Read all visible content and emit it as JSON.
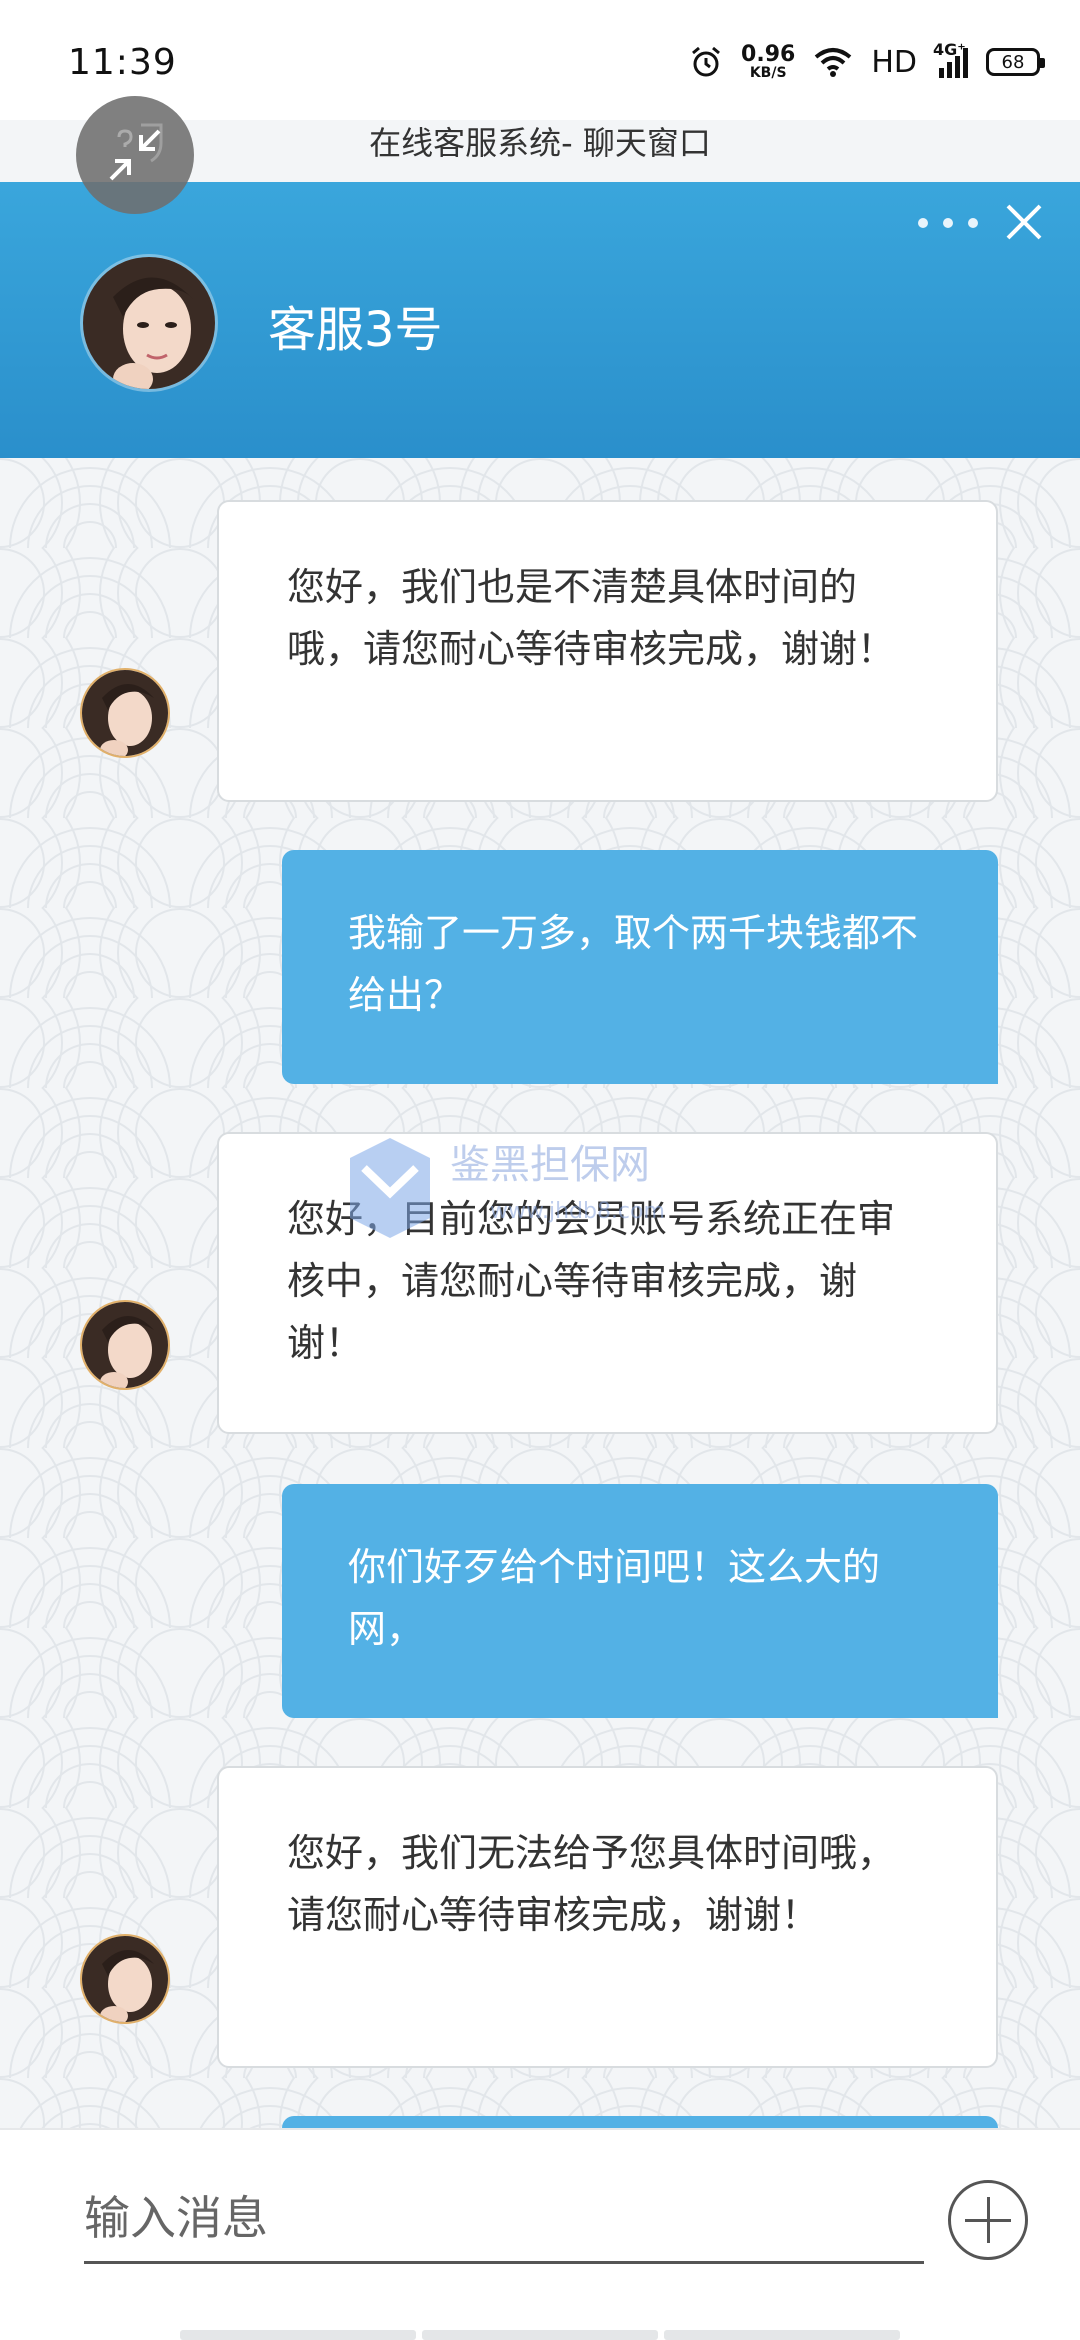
{
  "status_bar": {
    "time": "11:39",
    "net_speed_value": "0.96",
    "net_speed_unit": "KB/S",
    "hd_label": "HD",
    "network_label": "4G⁺",
    "battery_level": "68"
  },
  "window": {
    "title": "在线客服系统- 聊天窗口"
  },
  "header": {
    "agent_name": "客服3号"
  },
  "messages": [
    {
      "from": "agent",
      "text": "您好，我们也是不清楚具体时间的哦，请您耐心等待审核完成，谢谢！"
    },
    {
      "from": "user",
      "text": "我输了一万多，取个两千块钱都不给出？"
    },
    {
      "from": "agent",
      "text": "您好，目前您的会员账号系统正在审核中，请您耐心等待审核完成，谢谢！"
    },
    {
      "from": "user",
      "text": "你们好歹给个时间吧！这么大的网，"
    },
    {
      "from": "agent",
      "text": "您好，我们无法给予您具体时间哦，请您耐心等待审核完成，谢谢！"
    }
  ],
  "watermark": {
    "brand": "鉴黑担保网",
    "site": "www.jhdb8.com"
  },
  "input": {
    "placeholder": "输入消息"
  },
  "colors": {
    "header_blue": "#2a8fcb",
    "user_bubble": "#53b1e5",
    "agent_bubble": "#ffffff"
  },
  "icons": [
    "alarm-icon",
    "wifi-icon",
    "signal-icon",
    "battery-icon",
    "minimize-icon",
    "more-icon",
    "close-icon",
    "plus-icon"
  ]
}
